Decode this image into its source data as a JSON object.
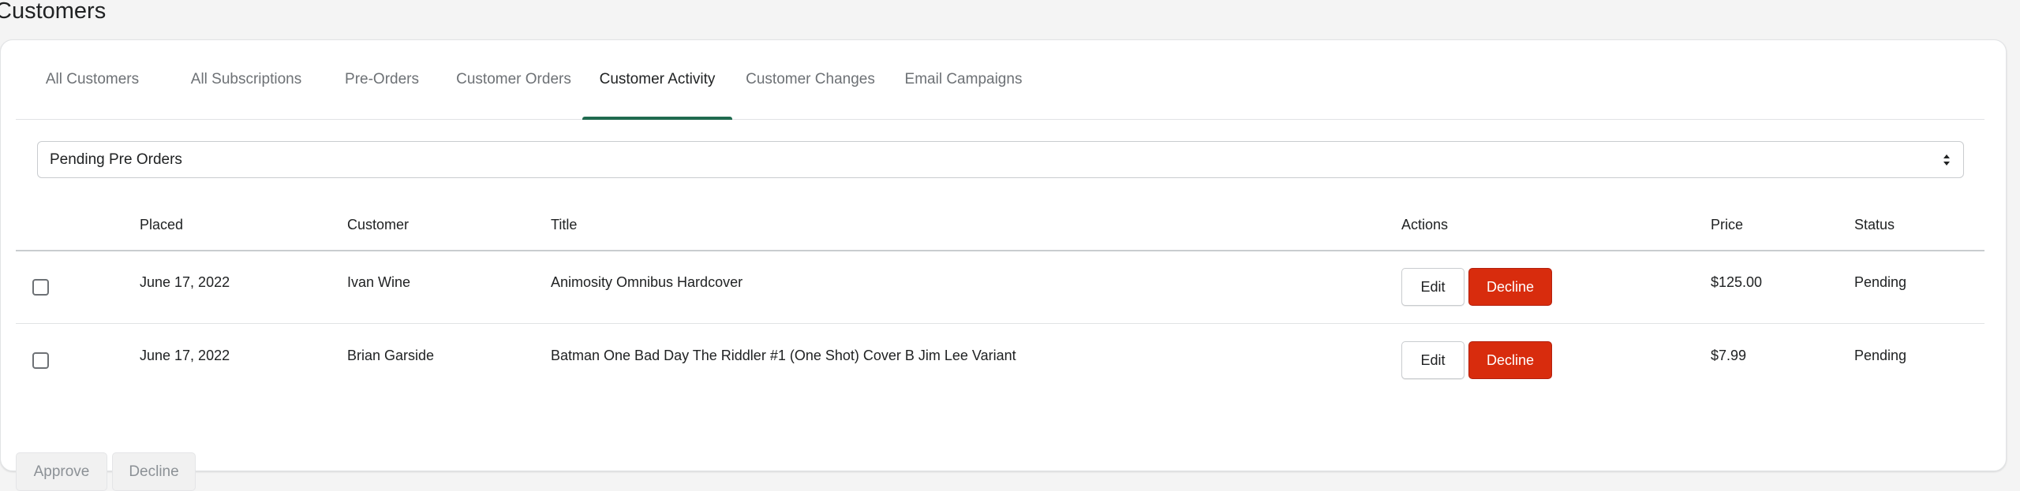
{
  "page": {
    "title": "Customers"
  },
  "tabs": [
    {
      "label": "All Customers"
    },
    {
      "label": "All Subscriptions"
    },
    {
      "label": "Pre-Orders"
    },
    {
      "label": "Customer Orders"
    },
    {
      "label": "Customer Activity",
      "active": true
    },
    {
      "label": "Customer Changes"
    },
    {
      "label": "Email Campaigns"
    }
  ],
  "filter": {
    "selected": "Pending Pre Orders"
  },
  "table": {
    "headers": {
      "placed": "Placed",
      "customer": "Customer",
      "title": "Title",
      "actions": "Actions",
      "price": "Price",
      "status": "Status"
    },
    "rows": [
      {
        "placed": "June 17, 2022",
        "customer": "Ivan Wine",
        "title": "Animosity Omnibus Hardcover",
        "edit_label": "Edit",
        "decline_label": "Decline",
        "price": "$125.00",
        "status": "Pending"
      },
      {
        "placed": "June 17, 2022",
        "customer": "Brian Garside",
        "title": "Batman One Bad Day The Riddler #1 (One Shot) Cover B Jim Lee Variant",
        "edit_label": "Edit",
        "decline_label": "Decline",
        "price": "$7.99",
        "status": "Pending"
      }
    ]
  },
  "bulk_actions": {
    "approve_label": "Approve",
    "decline_label": "Decline"
  },
  "colors": {
    "accent": "#1f6a4f",
    "danger": "#d82c0d"
  },
  "icons": {
    "select_caret": "select-caret-icon"
  }
}
